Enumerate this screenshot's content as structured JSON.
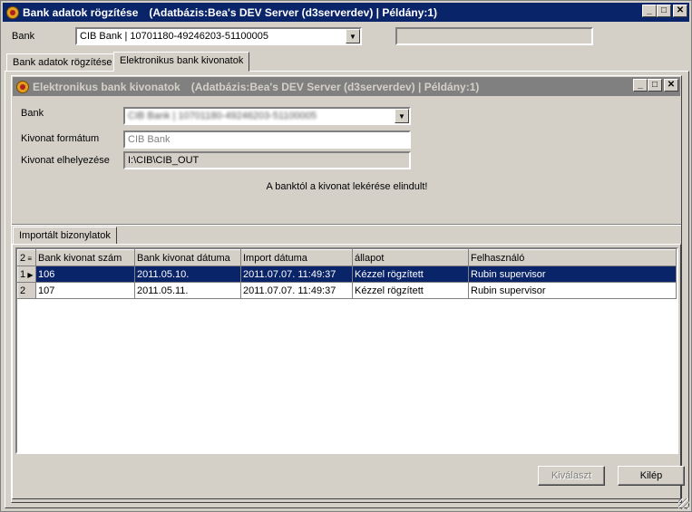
{
  "main_window": {
    "title": "Bank adatok rögzítése",
    "info": "(Adatbázis:Bea's DEV Server (d3serverdev) | Példány:1)",
    "bank_label": "Bank",
    "bank_value": "CIB Bank | 10701180-49246203-51100005",
    "right_field_value": ""
  },
  "tabs": [
    {
      "label": "Bank adatok rögzítése",
      "active": false
    },
    {
      "label": "Elektronikus bank kivonatok",
      "active": true
    }
  ],
  "child_window": {
    "title": "Elektronikus bank kivonatok",
    "info": "(Adatbázis:Bea's DEV Server (d3serverdev) | Példány:1)",
    "bank_label": "Bank",
    "bank_value": "CIB Bank | 10701180-49246203-51100005",
    "format_label": "Kivonat formátum",
    "format_value": "CIB Bank",
    "location_label": "Kivonat elhelyezése",
    "location_value": "I:\\CIB\\CIB_OUT",
    "status_message": "A banktól a kivonat lekérése elindult!"
  },
  "imported_tab": {
    "label": "Importált bizonylatok"
  },
  "grid": {
    "corner": "2",
    "columns": [
      "Bank kivonat szám",
      "Bank kivonat dátuma",
      "Import dátuma",
      "állapot",
      "Felhasználó"
    ],
    "rows": [
      {
        "index": "1",
        "selected": true,
        "cells": [
          "106",
          "2011.05.10.",
          "2011.07.07. 11:49:37",
          "Kézzel rögzített",
          "Rubin supervisor"
        ]
      },
      {
        "index": "2",
        "selected": false,
        "cells": [
          "107",
          "2011.05.11.",
          "2011.07.07. 11:49:37",
          "Kézzel rögzített",
          "Rubin supervisor"
        ]
      }
    ]
  },
  "buttons": {
    "select": "Kiválaszt",
    "exit": "Kilép"
  },
  "icons": {
    "minimize": "minimize-icon",
    "maximize": "maximize-icon",
    "close": "close-icon",
    "dropdown": "chevron-down-icon",
    "row_pointer": "row-pointer-icon"
  },
  "colors": {
    "active_titlebar": "#0a246a",
    "inactive_titlebar": "#808080",
    "window_bg": "#d4d0c8",
    "selection": "#0a246a"
  }
}
